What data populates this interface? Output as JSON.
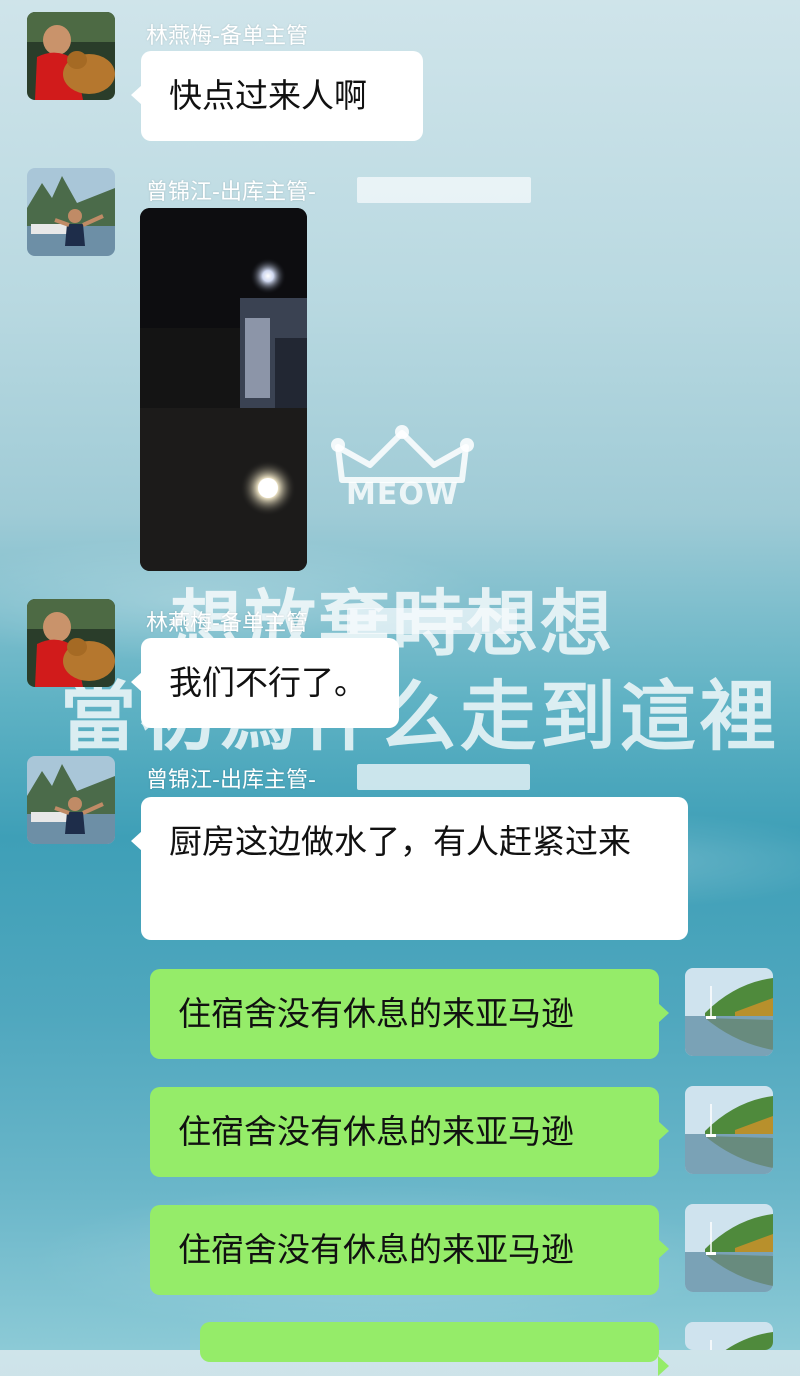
{
  "background": {
    "logo_text": "MEOW",
    "slogan_line1": "想放棄時想想",
    "slogan_line2": "當初爲什么走到這裡"
  },
  "messages": [
    {
      "type": "text",
      "side": "incoming",
      "sender": "林燕梅-备单主管",
      "avatar": "avatar-woman-with-dog",
      "text": "快点过来人啊"
    },
    {
      "type": "image",
      "side": "incoming",
      "sender": "曾锦江-出库主管-",
      "avatar": "avatar-man-on-boat",
      "image": "dark-warehouse-photo"
    },
    {
      "type": "text",
      "side": "incoming",
      "sender": "林燕梅-备单主管",
      "avatar": "avatar-woman-with-dog",
      "text": "我们不行了。"
    },
    {
      "type": "text",
      "side": "incoming",
      "sender": "曾锦江-出库主管-",
      "avatar": "avatar-man-on-boat",
      "text": "厨房这边做水了，有人赶紧过来"
    },
    {
      "type": "text",
      "side": "outgoing",
      "avatar": "avatar-lake-landscape",
      "text": "住宿舍没有休息的来亚马逊"
    },
    {
      "type": "text",
      "side": "outgoing",
      "avatar": "avatar-lake-landscape",
      "text": "住宿舍没有休息的来亚马逊"
    },
    {
      "type": "text",
      "side": "outgoing",
      "avatar": "avatar-lake-landscape",
      "text": "住宿舍没有休息的来亚马逊"
    },
    {
      "type": "text",
      "side": "outgoing",
      "avatar": "avatar-lake-landscape",
      "text": ""
    }
  ],
  "colors": {
    "outgoing_bubble": "#95ec69",
    "incoming_bubble": "#ffffff"
  }
}
